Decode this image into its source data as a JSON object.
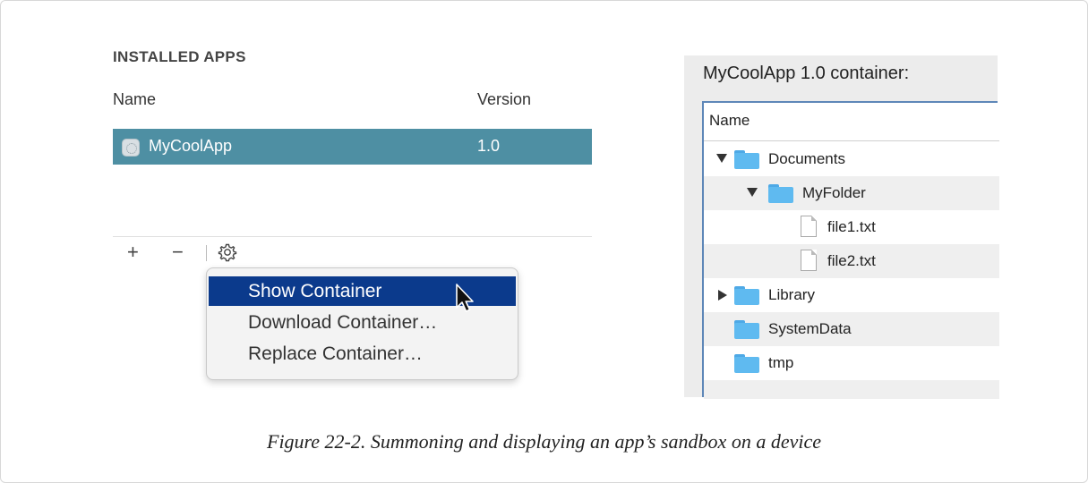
{
  "left_panel": {
    "heading": "INSTALLED APPS",
    "columns": {
      "name": "Name",
      "version": "Version"
    },
    "apps": [
      {
        "name": "MyCoolApp",
        "version": "1.0",
        "selected": true
      }
    ],
    "toolbar": {
      "add": "+",
      "remove": "−",
      "gear_icon": "gear-icon"
    }
  },
  "context_menu": {
    "items": [
      {
        "label": "Show Container",
        "selected": true
      },
      {
        "label": "Download Container…",
        "selected": false
      },
      {
        "label": "Replace Container…",
        "selected": false
      }
    ]
  },
  "right_panel": {
    "title": "MyCoolApp 1.0 container:",
    "column": "Name",
    "tree": [
      {
        "label": "Documents",
        "type": "folder",
        "expanded": true
      },
      {
        "label": "MyFolder",
        "type": "folder",
        "expanded": true
      },
      {
        "label": "file1.txt",
        "type": "file"
      },
      {
        "label": "file2.txt",
        "type": "file"
      },
      {
        "label": "Library",
        "type": "folder",
        "expanded": false
      },
      {
        "label": "SystemData",
        "type": "folder"
      },
      {
        "label": "tmp",
        "type": "folder"
      }
    ]
  },
  "caption": "Figure 22-2. Summoning and displaying an app’s sandbox on a device",
  "colors": {
    "selection_row": "#4e8fa3",
    "menu_highlight": "#0b3a8c",
    "folder": "#5fbaf0"
  }
}
